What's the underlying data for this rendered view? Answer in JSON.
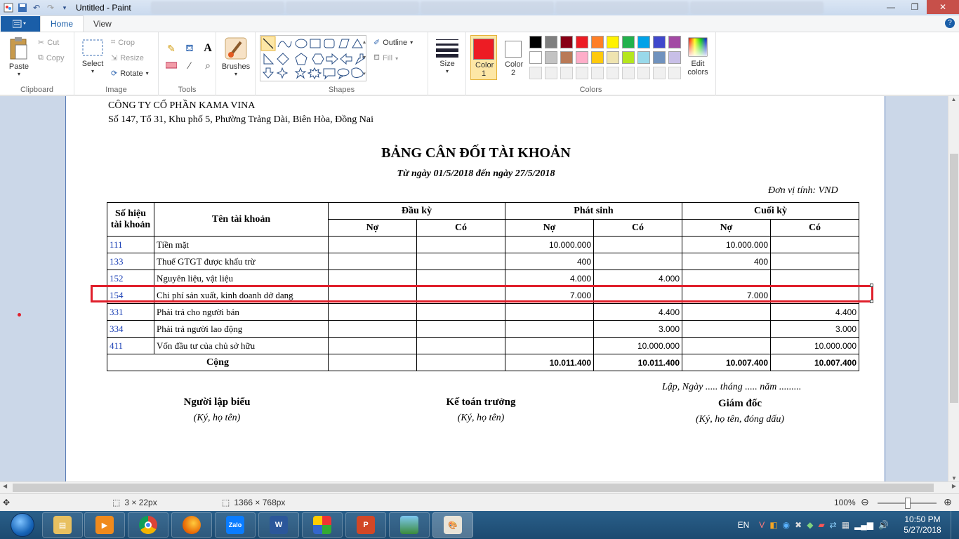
{
  "window": {
    "title": "Untitled - Paint"
  },
  "ribbon": {
    "file_label": "",
    "tabs": [
      {
        "label": "Home",
        "active": true
      },
      {
        "label": "View",
        "active": false
      }
    ],
    "clipboard": {
      "paste": "Paste",
      "cut": "Cut",
      "copy": "Copy",
      "label": "Clipboard"
    },
    "image": {
      "select": "Select",
      "crop": "Crop",
      "resize": "Resize",
      "rotate": "Rotate",
      "label": "Image"
    },
    "tools": {
      "label": "Tools"
    },
    "brushes": {
      "label": "Brushes"
    },
    "shapes": {
      "outline": "Outline",
      "fill": "Fill",
      "label": "Shapes"
    },
    "size": {
      "label": "Size"
    },
    "colors": {
      "color1": "Color 1",
      "color2": "Color 2",
      "edit": "Edit colors",
      "label": "Colors",
      "color1_value": "#ed1c24",
      "color2_value": "#ffffff",
      "palette_row1": [
        "#000000",
        "#7f7f7f",
        "#880015",
        "#ed1c24",
        "#ff7f27",
        "#fff200",
        "#22b14c",
        "#00a2e8",
        "#3f48cc",
        "#a349a4"
      ],
      "palette_row2": [
        "#ffffff",
        "#c3c3c3",
        "#b97a57",
        "#ffaec9",
        "#ffc90e",
        "#efe4b0",
        "#b5e61d",
        "#99d9ea",
        "#7092be",
        "#c8bfe7"
      ]
    }
  },
  "document": {
    "company": "CÔNG TY CỔ PHẦN KAMA VINA",
    "address": "Số 147, Tổ 31, Khu phố 5, Phường Trảng Dài, Biên Hòa, Đồng Nai",
    "title": "BẢNG CÂN ĐỐI TÀI KHOẢN",
    "subtitle": "Từ ngày 01/5/2018 đến ngày 27/5/2018",
    "unit": "Đơn vị tính: VND",
    "table": {
      "h_code": "Số hiệu tài khoản",
      "h_name": "Tên tài khoản",
      "h_open": "Đầu kỳ",
      "h_period": "Phát sinh",
      "h_close": "Cuối kỳ",
      "h_debit": "Nợ",
      "h_credit": "Có",
      "rows": [
        {
          "code": "111",
          "name": "Tiền mặt",
          "od": "",
          "oc": "",
          "pd": "10.000.000",
          "pc": "",
          "cd": "10.000.000",
          "cc": ""
        },
        {
          "code": "133",
          "name": "Thuế GTGT được khấu trừ",
          "od": "",
          "oc": "",
          "pd": "400",
          "pc": "",
          "cd": "400",
          "cc": ""
        },
        {
          "code": "152",
          "name": "Nguyên liệu, vật liệu",
          "od": "",
          "oc": "",
          "pd": "4.000",
          "pc": "4.000",
          "cd": "",
          "cc": ""
        },
        {
          "code": "154",
          "name": "Chi phí sản xuất, kinh doanh dở dang",
          "od": "",
          "oc": "",
          "pd": "7.000",
          "pc": "",
          "cd": "7.000",
          "cc": ""
        },
        {
          "code": "331",
          "name": "Phải trả cho người bán",
          "od": "",
          "oc": "",
          "pd": "",
          "pc": "4.400",
          "cd": "",
          "cc": "4.400"
        },
        {
          "code": "334",
          "name": "Phải trả người lao động",
          "od": "",
          "oc": "",
          "pd": "",
          "pc": "3.000",
          "cd": "",
          "cc": "3.000"
        },
        {
          "code": "411",
          "name": "Vốn đầu tư của chủ sở hữu",
          "od": "",
          "oc": "",
          "pd": "",
          "pc": "10.000.000",
          "cd": "",
          "cc": "10.000.000"
        }
      ],
      "total": {
        "label": "Cộng",
        "pd": "10.011.400",
        "pc": "10.011.400",
        "cd": "10.007.400",
        "cc": "10.007.400"
      }
    },
    "dateline": "Lập, Ngày ..... tháng ..... năm .........",
    "signatures": [
      {
        "title": "Người lập biểu",
        "sub": "(Ký, họ tên)"
      },
      {
        "title": "Kế toán trưởng",
        "sub": "(Ký, họ tên)"
      },
      {
        "title": "Giám đốc",
        "sub": "(Ký, họ tên, đóng dấu)"
      }
    ]
  },
  "statusbar": {
    "selection": "3 × 22px",
    "canvas": "1366 × 768px",
    "zoom": "100%"
  },
  "taskbar": {
    "lang": "EN",
    "time": "10:50 PM",
    "date": "5/27/2018"
  }
}
